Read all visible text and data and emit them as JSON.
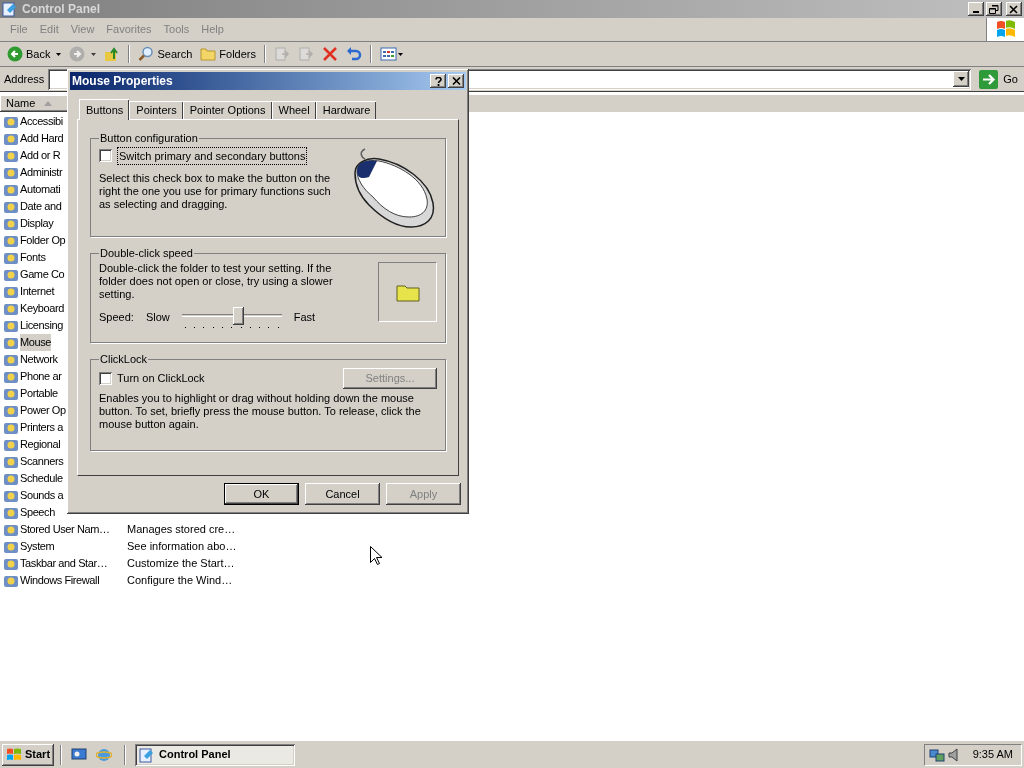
{
  "window": {
    "title": "Control Panel"
  },
  "menu": [
    "File",
    "Edit",
    "View",
    "Favorites",
    "Tools",
    "Help"
  ],
  "toolbar": [
    {
      "kind": "back",
      "label": "Back",
      "disabled": false
    },
    {
      "kind": "forward",
      "disabled": true
    },
    {
      "kind": "up",
      "disabled": false
    },
    {
      "kind": "search",
      "label": "Search",
      "disabled": false
    },
    {
      "kind": "folders",
      "label": "Folders",
      "disabled": false
    },
    {
      "kind": "move",
      "disabled": true
    },
    {
      "kind": "copy",
      "disabled": true
    },
    {
      "kind": "delete",
      "disabled": false
    },
    {
      "kind": "undo",
      "disabled": false
    },
    {
      "kind": "views",
      "disabled": false
    }
  ],
  "address": {
    "label": "Address",
    "go": "Go"
  },
  "list": {
    "columns": [
      "Name"
    ],
    "rows": [
      {
        "name": "Accessibi",
        "selected": false
      },
      {
        "name": "Add Hard",
        "selected": false
      },
      {
        "name": "Add or R",
        "selected": false
      },
      {
        "name": "Administr",
        "selected": false
      },
      {
        "name": "Automati",
        "selected": false
      },
      {
        "name": "Date and",
        "selected": false
      },
      {
        "name": "Display",
        "selected": false
      },
      {
        "name": "Folder Op",
        "selected": false
      },
      {
        "name": "Fonts",
        "selected": false
      },
      {
        "name": "Game Co",
        "selected": false
      },
      {
        "name": "Internet",
        "selected": false
      },
      {
        "name": "Keyboard",
        "selected": false
      },
      {
        "name": "Licensing",
        "selected": false
      },
      {
        "name": "Mouse",
        "selected": true
      },
      {
        "name": "Network",
        "selected": false
      },
      {
        "name": "Phone ar",
        "selected": false
      },
      {
        "name": "Portable",
        "selected": false
      },
      {
        "name": "Power Op",
        "selected": false
      },
      {
        "name": "Printers a",
        "selected": false
      },
      {
        "name": "Regional",
        "selected": false
      },
      {
        "name": "Scanners",
        "selected": false
      },
      {
        "name": "Schedule",
        "selected": false
      },
      {
        "name": "Sounds a",
        "selected": false
      },
      {
        "name": "Speech",
        "selected": false
      },
      {
        "name": "Stored User Nam…",
        "description": "Manages stored cre…",
        "selected": false
      },
      {
        "name": "System",
        "description": "See information abo…",
        "selected": false
      },
      {
        "name": "Taskbar and Star…",
        "description": "Customize the Start…",
        "selected": false
      },
      {
        "name": "Windows Firewall",
        "description": "Configure the Wind…",
        "selected": false
      }
    ]
  },
  "dialog": {
    "title": "Mouse Properties",
    "tabs": [
      {
        "label": "Buttons",
        "selected": true
      },
      {
        "label": "Pointers",
        "selected": false
      },
      {
        "label": "Pointer Options",
        "selected": false
      },
      {
        "label": "Wheel",
        "selected": false
      },
      {
        "label": "Hardware",
        "selected": false
      }
    ],
    "button_configuration": {
      "title": "Button configuration",
      "checkbox": {
        "label": "Switch primary and secondary buttons",
        "checked": false
      },
      "description": "Select this check box to make the button on the right the one you use for primary functions such as selecting and dragging."
    },
    "double_click_speed": {
      "title": "Double-click speed",
      "description": "Double-click the folder to test your setting. If the folder does not open or close, try using a slower setting.",
      "speed_label": "Speed:",
      "slow": "Slow",
      "fast": "Fast",
      "level": 0.58
    },
    "clicklock": {
      "title": "ClickLock",
      "checkbox": {
        "label": "Turn on ClickLock",
        "checked": false
      },
      "settings": {
        "label": "Settings...",
        "disabled": true
      },
      "description": "Enables you to highlight or drag without holding down the mouse button. To set, briefly press the mouse button. To release, click the mouse button again."
    },
    "buttons": [
      {
        "label": "OK",
        "disabled": false,
        "default": true
      },
      {
        "label": "Cancel",
        "disabled": false,
        "default": false
      },
      {
        "label": "Apply",
        "disabled": true,
        "default": false
      }
    ]
  },
  "taskbar": {
    "start": "Start",
    "tasks": [
      {
        "label": "Control Panel",
        "selected": true
      }
    ],
    "clock": "9:35 AM"
  }
}
